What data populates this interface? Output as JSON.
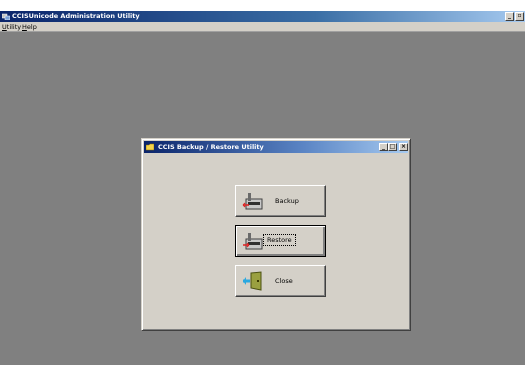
{
  "app": {
    "title": "CCISUnicode Administration Utility",
    "menu": [
      {
        "label_u": "U",
        "label_rest": "tility"
      },
      {
        "label_u": "H",
        "label_rest": "elp"
      }
    ]
  },
  "dialog": {
    "title": "CCIS Backup / Restore Utility",
    "buttons": {
      "backup": "Backup",
      "restore": "Restore",
      "close": "Close"
    }
  },
  "colors": {
    "workspace": "#808080",
    "face": "#d4d0c8",
    "titlebar_start": "#0a246a",
    "titlebar_end": "#a6caf0"
  }
}
